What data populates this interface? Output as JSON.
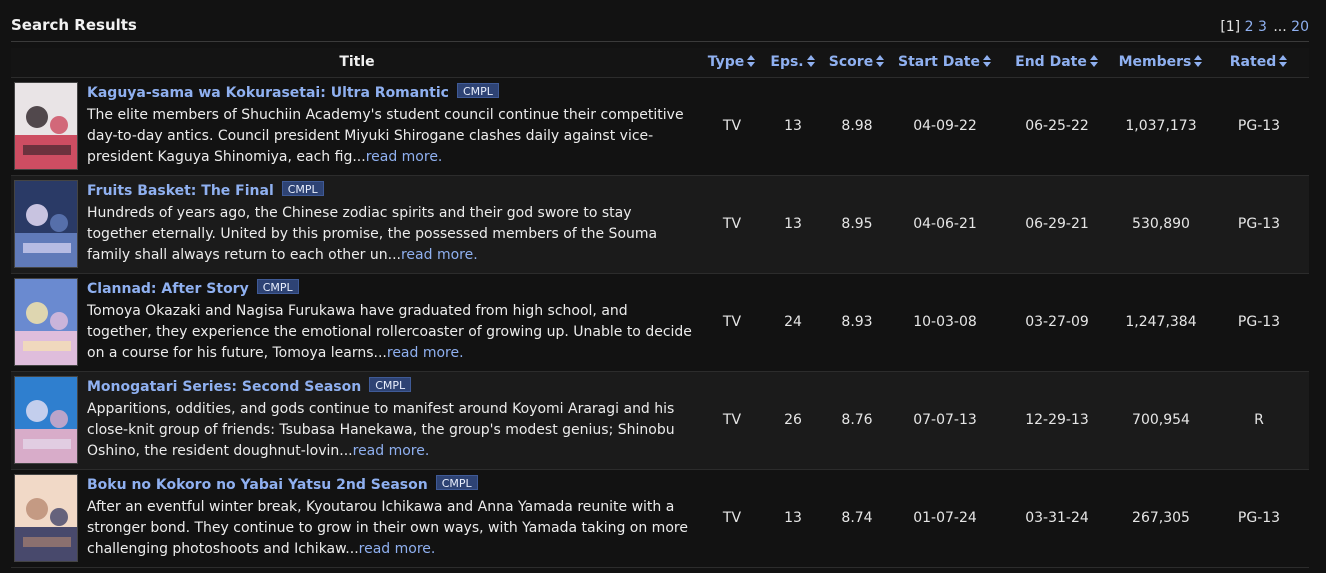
{
  "header": {
    "title": "Search Results",
    "pager": {
      "current": "[1]",
      "pages": [
        "2",
        "3"
      ],
      "ellipsis": "...",
      "last": "20"
    }
  },
  "columns": {
    "title": "Title",
    "type": "Type",
    "eps": "Eps.",
    "score": "Score",
    "start": "Start Date",
    "end": "End Date",
    "members": "Members",
    "rated": "Rated"
  },
  "rows": [
    {
      "title": "Kaguya-sama wa Kokurasetai: Ultra Romantic",
      "badge": "CMPL",
      "synopsis": "The elite members of Shuchiin Academy's student council continue their competitive day-to-day antics. Council president Miyuki Shirogane clashes daily against vice-president Kaguya Shinomiya, each fig...",
      "read_more": "read more.",
      "type": "TV",
      "eps": "13",
      "score": "8.98",
      "start": "04-09-22",
      "end": "06-25-22",
      "members": "1,037,173",
      "rated": "PG-13"
    },
    {
      "title": "Fruits Basket: The Final",
      "badge": "CMPL",
      "synopsis": "Hundreds of years ago, the Chinese zodiac spirits and their god swore to stay together eternally. United by this promise, the possessed members of the Souma family shall always return to each other un...",
      "read_more": "read more.",
      "type": "TV",
      "eps": "13",
      "score": "8.95",
      "start": "04-06-21",
      "end": "06-29-21",
      "members": "530,890",
      "rated": "PG-13"
    },
    {
      "title": "Clannad: After Story",
      "badge": "CMPL",
      "synopsis": "Tomoya Okazaki and Nagisa Furukawa have graduated from high school, and together, they experience the emotional rollercoaster of growing up. Unable to decide on a course for his future, Tomoya learns...",
      "read_more": "read more.",
      "type": "TV",
      "eps": "24",
      "score": "8.93",
      "start": "10-03-08",
      "end": "03-27-09",
      "members": "1,247,384",
      "rated": "PG-13"
    },
    {
      "title": "Monogatari Series: Second Season",
      "badge": "CMPL",
      "synopsis": "Apparitions, oddities, and gods continue to manifest around Koyomi Araragi and his close-knit group of friends: Tsubasa Hanekawa, the group's modest genius; Shinobu Oshino, the resident doughnut-lovin...",
      "read_more": "read more.",
      "type": "TV",
      "eps": "26",
      "score": "8.76",
      "start": "07-07-13",
      "end": "12-29-13",
      "members": "700,954",
      "rated": "R"
    },
    {
      "title": "Boku no Kokoro no Yabai Yatsu 2nd Season",
      "badge": "CMPL",
      "synopsis": "After an eventful winter break, Kyoutarou Ichikawa and Anna Yamada reunite with a stronger bond. They continue to grow in their own ways, with Yamada taking on more challenging photoshoots and Ichikaw...",
      "read_more": "read more.",
      "type": "TV",
      "eps": "13",
      "score": "8.74",
      "start": "01-07-24",
      "end": "03-31-24",
      "members": "267,305",
      "rated": "PG-13"
    }
  ],
  "thumb_colors": [
    [
      "#e9e4e6",
      "#c8334a",
      "#2b2126"
    ],
    [
      "#2a3a66",
      "#6a86c8",
      "#f0e6ff"
    ],
    [
      "#6a8ad0",
      "#f3c6de",
      "#fbe9a8"
    ],
    [
      "#2f7fcf",
      "#f6b4c8",
      "#e8e2f4"
    ],
    [
      "#f1d9c7",
      "#2a2f5c",
      "#b98a72"
    ]
  ],
  "colors": {
    "link": "#8fb0f0",
    "badge_bg": "#2e4374",
    "background": "#121212",
    "row_alt": "#1b1b1b"
  }
}
